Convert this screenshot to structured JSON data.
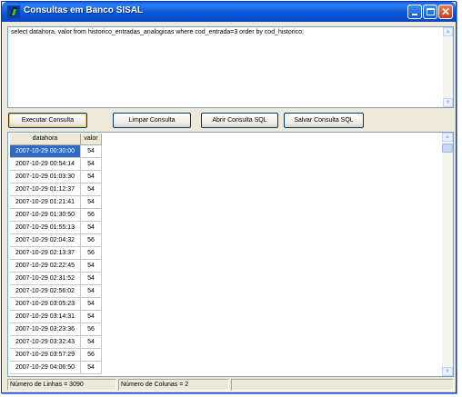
{
  "window": {
    "title": "Consultas em Banco SISAL"
  },
  "query": {
    "text": "select datahora, valor from historico_entradas_analogicas where cod_entrada=3 order by cod_historico;"
  },
  "buttons": {
    "execute": "Executar Consulta",
    "clear": "Limpar Consulta",
    "open": "Abrir Consulta SQL",
    "save": "Salvar Consulta SQL"
  },
  "grid": {
    "columns": [
      "datahora",
      "valor"
    ],
    "rows": [
      {
        "datahora": "2007-10-29 00:30:00",
        "valor": "54"
      },
      {
        "datahora": "2007-10-29 00:54:14",
        "valor": "54"
      },
      {
        "datahora": "2007-10-29 01:03:30",
        "valor": "54"
      },
      {
        "datahora": "2007-10-29 01:12:37",
        "valor": "54"
      },
      {
        "datahora": "2007-10-29 01:21:41",
        "valor": "54"
      },
      {
        "datahora": "2007-10-29 01:30:50",
        "valor": "56"
      },
      {
        "datahora": "2007-10-29 01:55:13",
        "valor": "54"
      },
      {
        "datahora": "2007-10-29 02:04:32",
        "valor": "56"
      },
      {
        "datahora": "2007-10-29 02:13:37",
        "valor": "56"
      },
      {
        "datahora": "2007-10-29 02:22:45",
        "valor": "54"
      },
      {
        "datahora": "2007-10-29 02:31:52",
        "valor": "54"
      },
      {
        "datahora": "2007-10-29 02:56:02",
        "valor": "54"
      },
      {
        "datahora": "2007-10-29 03:05:23",
        "valor": "54"
      },
      {
        "datahora": "2007-10-29 03:14:31",
        "valor": "54"
      },
      {
        "datahora": "2007-10-29 03:23:36",
        "valor": "56"
      },
      {
        "datahora": "2007-10-29 03:32:43",
        "valor": "54"
      },
      {
        "datahora": "2007-10-29 03:57:29",
        "valor": "56"
      },
      {
        "datahora": "2007-10-29 04:06:50",
        "valor": "54"
      }
    ],
    "selected_row": 0
  },
  "status": {
    "rows": "Número de Linhas = 3090",
    "cols": "Número de Colunas = 2",
    "extra": ""
  },
  "colors": {
    "titlebar": "#0a58d8",
    "selection": "#316ac5",
    "window_bg": "#ece9d8"
  },
  "icons": {
    "app": "sisal-app-icon",
    "minimize": "minimize-icon",
    "maximize": "maximize-icon",
    "close": "close-icon"
  }
}
